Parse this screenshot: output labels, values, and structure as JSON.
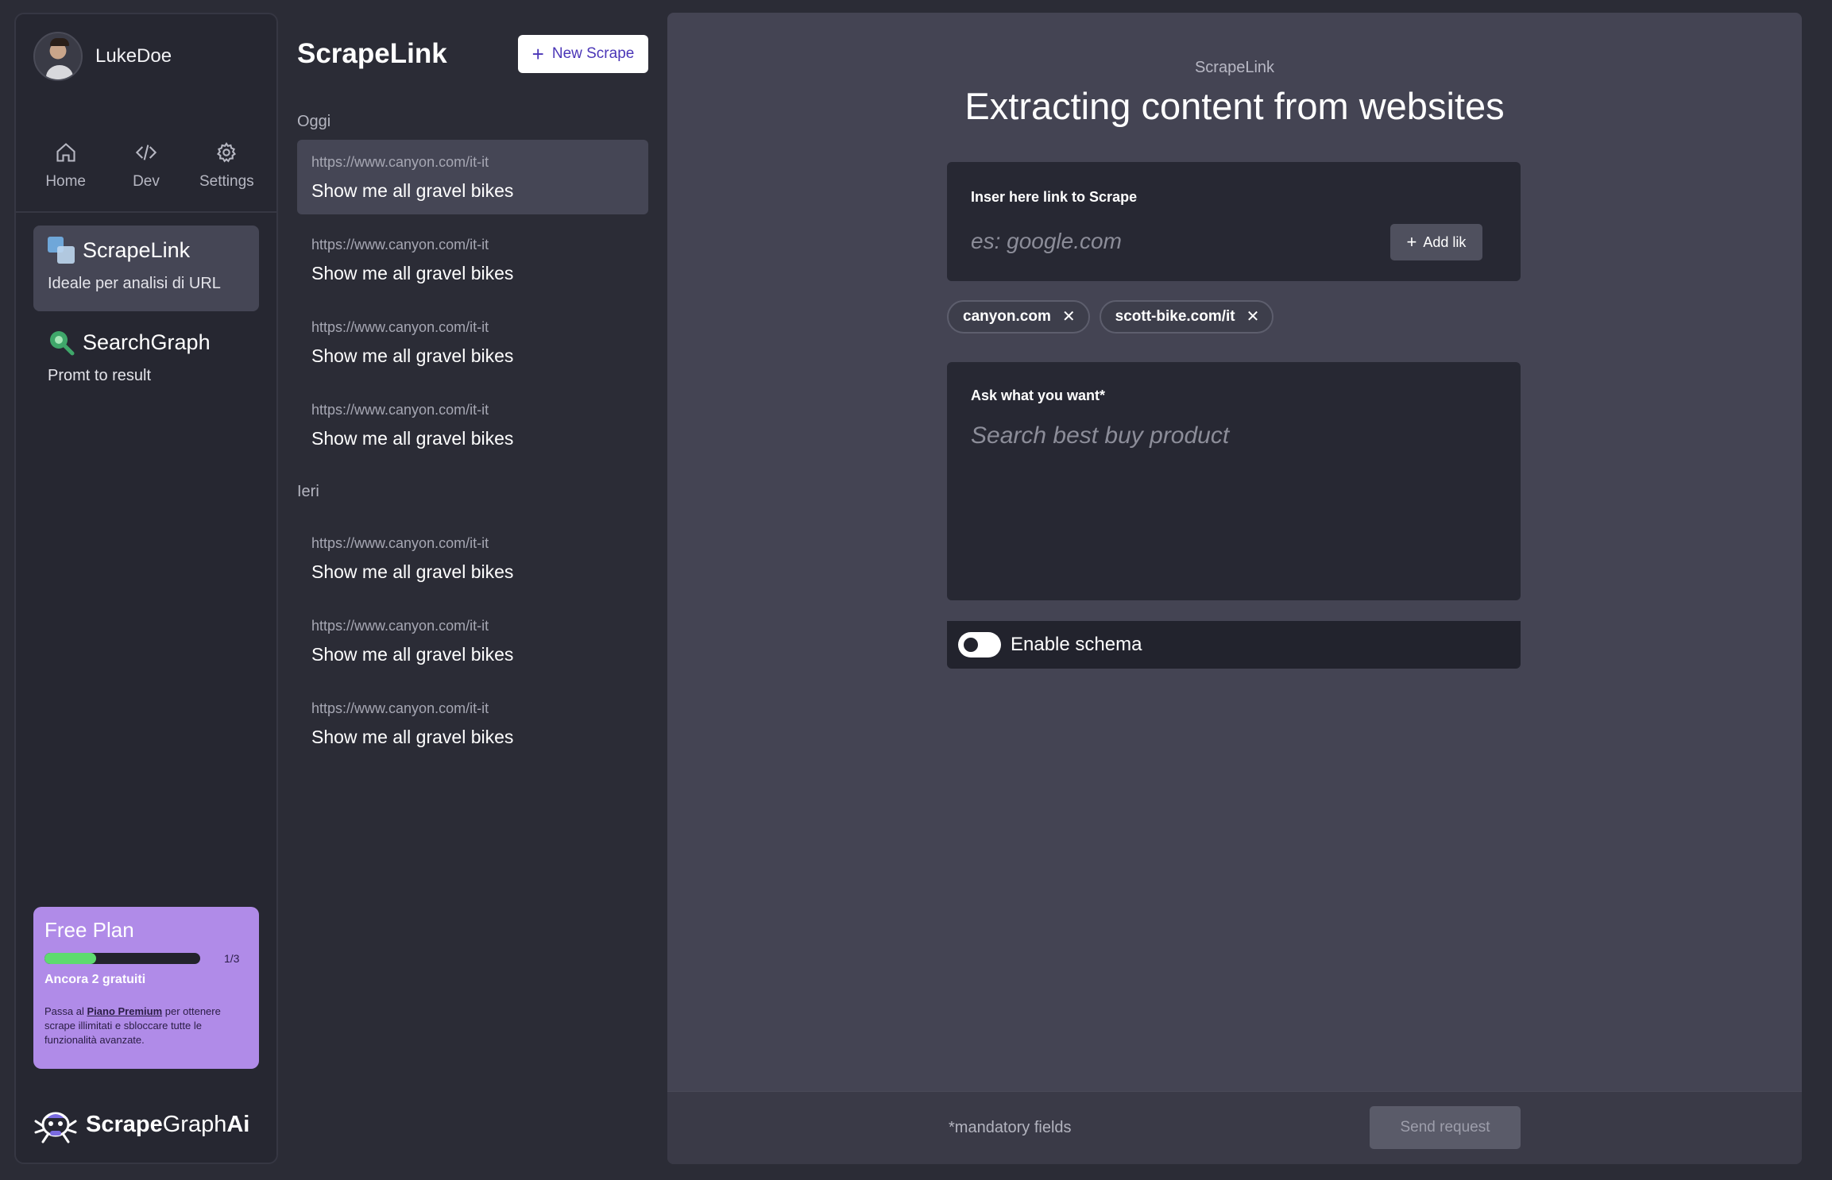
{
  "user": {
    "name": "LukeDoe"
  },
  "topnav": [
    {
      "label": "Home",
      "icon": "home-icon"
    },
    {
      "label": "Dev",
      "icon": "code-icon"
    },
    {
      "label": "Settings",
      "icon": "gear-icon"
    }
  ],
  "tools": [
    {
      "title": "ScrapeLink",
      "subtitle": "Ideale per analisi di URL",
      "icon": "scrapelink-logo-icon",
      "active": true
    },
    {
      "title": "SearchGraph",
      "subtitle": "Promt to result",
      "icon": "searchgraph-logo-icon",
      "active": false
    }
  ],
  "plan": {
    "title": "Free Plan",
    "progress_fraction": 0.333,
    "count": "1/3",
    "remaining": "Ancora 2 gratuiti",
    "desc_prefix": "Passa al ",
    "desc_link": "Piano Premium",
    "desc_suffix": " per ottenere scrape illimitati e sbloccare tutte le funzionalità avanzate.",
    "bar_color": "#5ddb6f",
    "bg_color": "#b08be8"
  },
  "brand": {
    "name_a": "Scrape",
    "name_b": "Graph",
    "name_c": "Ai"
  },
  "history": {
    "title": "ScrapeLink",
    "new_button": "New Scrape",
    "sections": [
      {
        "label": "Oggi",
        "items": [
          {
            "url": "https://www.canyon.com/it-it",
            "query": "Show me all gravel bikes",
            "active": true
          },
          {
            "url": "https://www.canyon.com/it-it",
            "query": "Show me all gravel bikes",
            "active": false
          },
          {
            "url": "https://www.canyon.com/it-it",
            "query": "Show me all gravel bikes",
            "active": false
          },
          {
            "url": "https://www.canyon.com/it-it",
            "query": "Show me all gravel bikes",
            "active": false
          }
        ]
      },
      {
        "label": "Ieri",
        "items": [
          {
            "url": "https://www.canyon.com/it-it",
            "query": "Show me all gravel bikes",
            "active": false
          },
          {
            "url": "https://www.canyon.com/it-it",
            "query": "Show me all gravel bikes",
            "active": false
          },
          {
            "url": "https://www.canyon.com/it-it",
            "query": "Show me all gravel bikes",
            "active": false
          }
        ]
      }
    ]
  },
  "main": {
    "kicker": "ScrapeLink",
    "title": "Extracting content from websites",
    "link_card": {
      "label": "Inser here link to Scrape",
      "placeholder": "es: google.com",
      "add_button": "Add lik"
    },
    "chips": [
      "canyon.com",
      "scott-bike.com/it"
    ],
    "ask_card": {
      "label": "Ask what you want*",
      "placeholder": "Search best buy product"
    },
    "schema": {
      "label": "Enable schema",
      "enabled": false
    },
    "footer": {
      "mandatory": "*mandatory fields",
      "send_button": "Send request"
    }
  }
}
